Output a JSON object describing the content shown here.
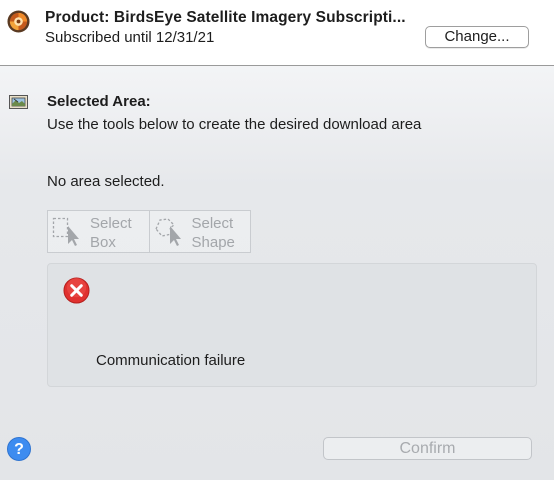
{
  "header": {
    "icon": "product-logo-icon",
    "title": "Product: BirdsEye Satellite Imagery Subscripti...",
    "subscription": "Subscribed until 12/31/21",
    "change_label": "Change..."
  },
  "selection": {
    "icon": "area-map-icon",
    "title": "Selected Area:",
    "description": "Use the tools below to create the desired download area",
    "status": "No area selected."
  },
  "tools": [
    {
      "icon": "select-box-icon",
      "line1": "Select",
      "line2": "Box"
    },
    {
      "icon": "select-shape-icon",
      "line1": "Select",
      "line2": "Shape"
    }
  ],
  "message": {
    "icon": "error-icon",
    "text": "Communication failure"
  },
  "footer": {
    "help_icon": "help-icon",
    "help_label": "?",
    "confirm_label": "Confirm"
  },
  "colors": {
    "accent": "#3d8cf0",
    "error": "#e0312f",
    "disabled_text": "#a3a6aa"
  }
}
